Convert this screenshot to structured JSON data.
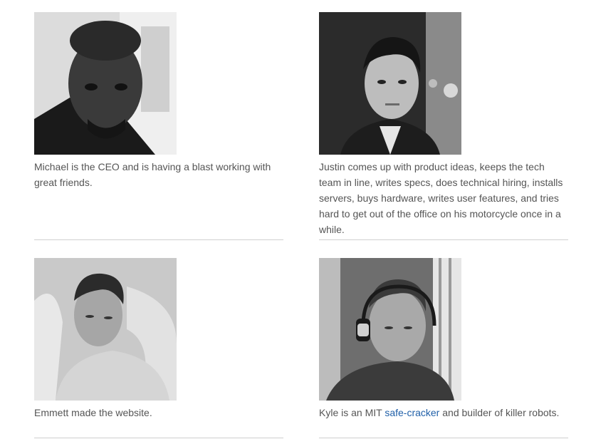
{
  "team": [
    {
      "id": "michael",
      "photo_icon": "person-portrait-icon",
      "bio": "Michael is the CEO and is having a blast working with great friends."
    },
    {
      "id": "justin",
      "photo_icon": "person-portrait-icon",
      "bio": "Justin comes up with product ideas, keeps the tech team in line, writes specs, does technical hiring, installs servers, buys hardware, writes user features, and tries hard to get out of the office on his motorcycle once in a while."
    },
    {
      "id": "emmett",
      "photo_icon": "person-portrait-icon",
      "bio": "Emmett made the website."
    },
    {
      "id": "kyle",
      "photo_icon": "person-portrait-icon",
      "bio_prefix": "Kyle is an MIT ",
      "bio_link": "safe-cracker",
      "bio_suffix": " and builder of killer robots."
    }
  ],
  "colors": {
    "text": "#555555",
    "link": "#1f5fa8",
    "divider": "#cfcfcf"
  }
}
